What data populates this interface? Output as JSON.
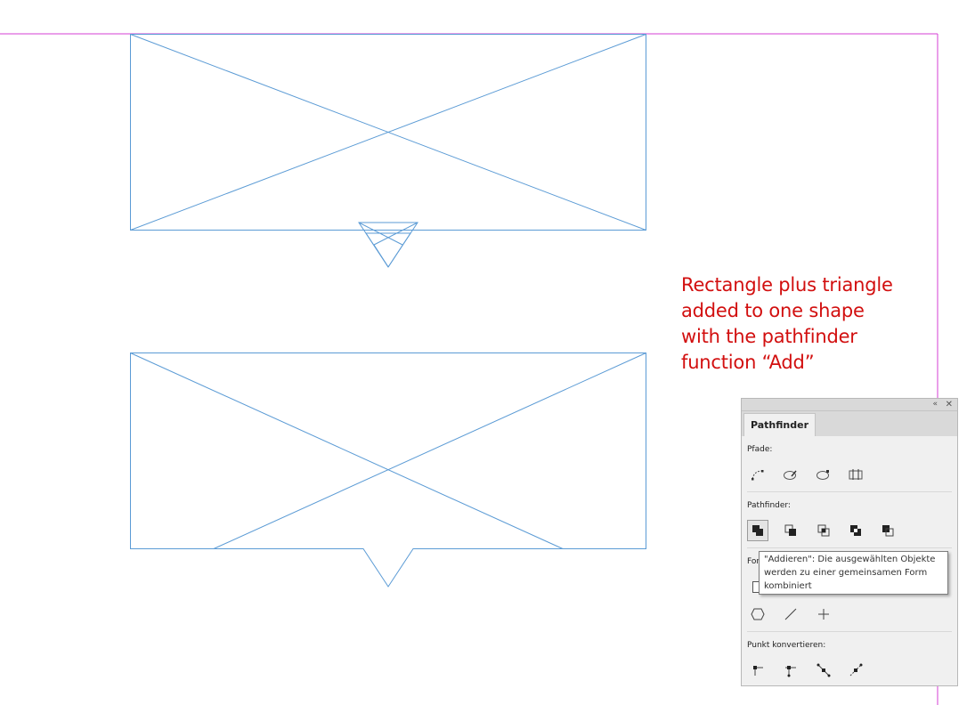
{
  "annotation": {
    "lines": [
      "Rectangle plus triangle",
      "added to one shape",
      "with the pathfinder",
      "function “Add”"
    ]
  },
  "panel": {
    "tab_label": "Pathfinder",
    "paths_label": "Pfade:",
    "pathfinder_label": "Pathfinder:",
    "shape_label_partial": "For",
    "convert_point_label": "Punkt konvertieren:",
    "collapse_icon": "«",
    "close_icon": "✕"
  },
  "tooltip": {
    "line1": "\"Addieren\": Die ausgewählten Objekte",
    "line2": "werden zu einer gemeinsamen Form",
    "line3": "kombiniert"
  },
  "colors": {
    "frame_stroke": "#5b9bd5",
    "page_border": "#d63fd6",
    "annotation": "#d20f0f"
  }
}
